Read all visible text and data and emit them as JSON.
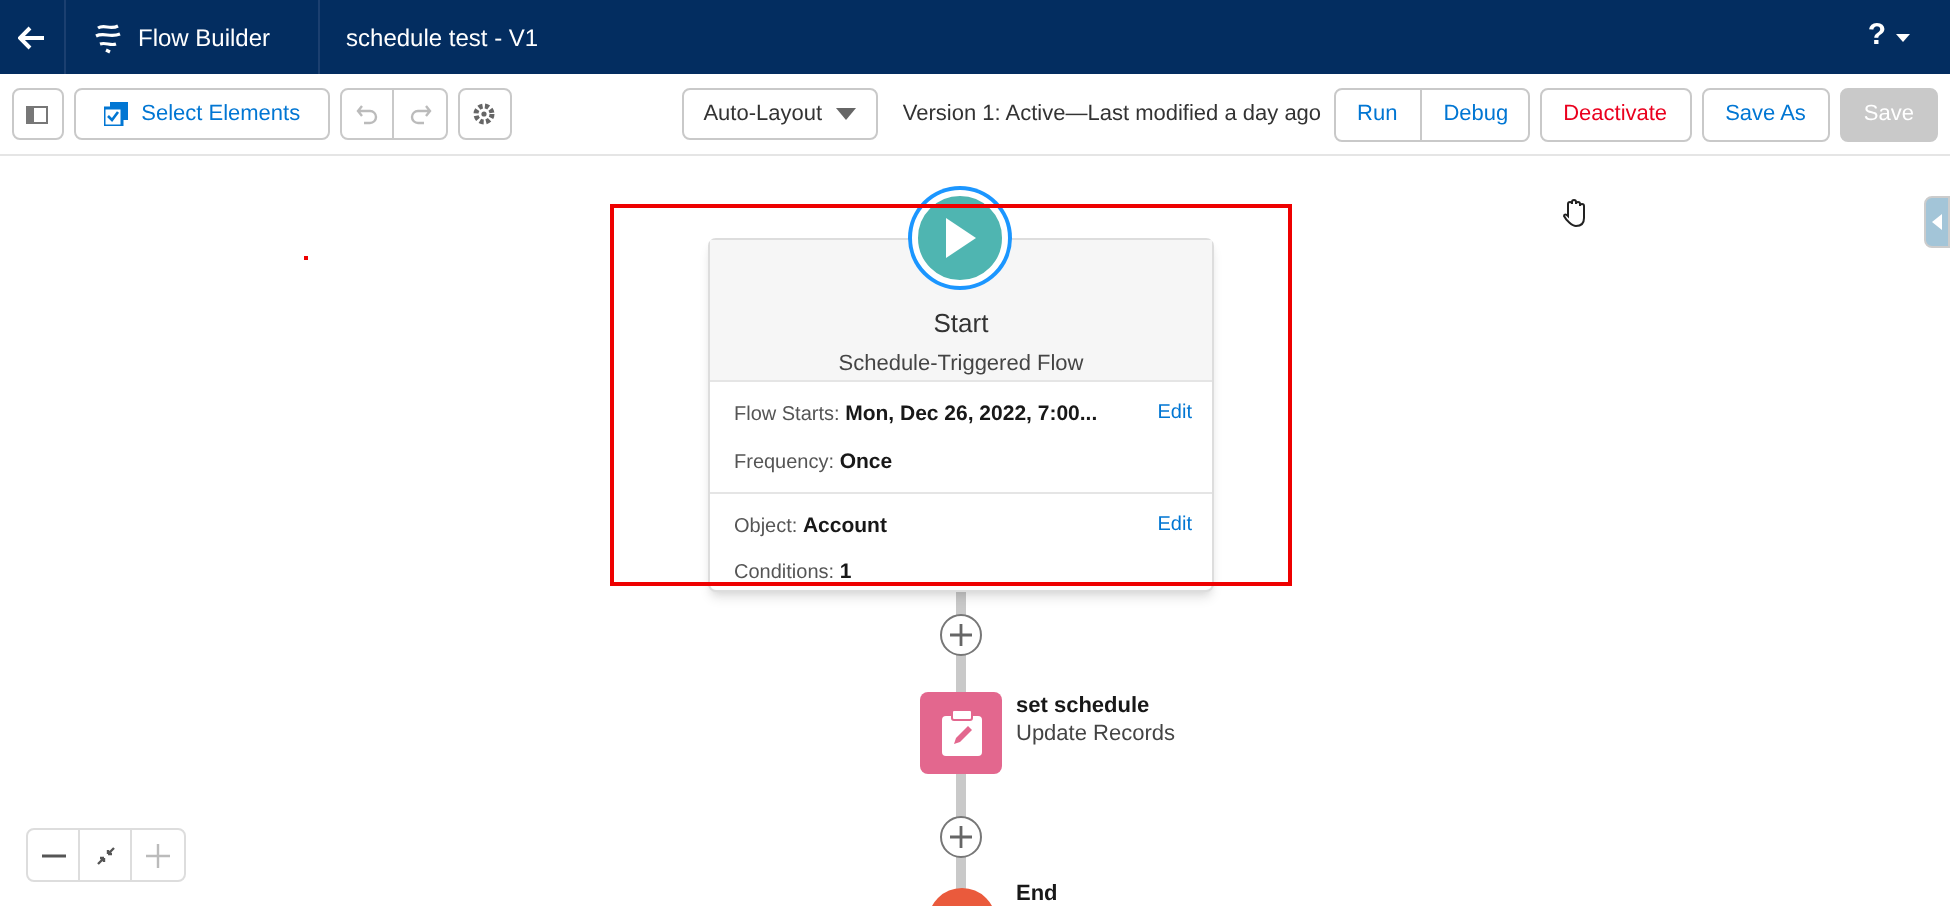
{
  "header": {
    "app_name": "Flow Builder",
    "flow_title": "schedule test - V1",
    "help": "?"
  },
  "toolbar": {
    "select_elements": "Select Elements",
    "layout_dropdown": "Auto-Layout",
    "version_status": "Version 1: Active—Last modified a day ago",
    "buttons": [
      {
        "label": "Run",
        "kind": "group",
        "disabled": false
      },
      {
        "label": "Debug",
        "kind": "group",
        "disabled": false
      },
      {
        "label": "Deactivate",
        "kind": "danger",
        "disabled": false
      },
      {
        "label": "Save As",
        "kind": "plain",
        "disabled": false
      },
      {
        "label": "Save",
        "kind": "plain",
        "disabled": true
      }
    ]
  },
  "start_node": {
    "title": "Start",
    "subtitle": "Schedule-Triggered Flow",
    "sections": [
      {
        "edit": "Edit",
        "fields": [
          {
            "label": "Flow Starts:",
            "value": "Mon, Dec 26, 2022, 7:00..."
          },
          {
            "label": "Frequency:",
            "value": "Once"
          }
        ]
      },
      {
        "edit": "Edit",
        "fields": [
          {
            "label": "Object:",
            "value": "Account"
          },
          {
            "label": "Conditions:",
            "value": "1"
          }
        ]
      }
    ]
  },
  "elements": [
    {
      "kind": "action",
      "name": "set schedule",
      "type": "Update Records"
    },
    {
      "kind": "end",
      "name": "End"
    }
  ]
}
